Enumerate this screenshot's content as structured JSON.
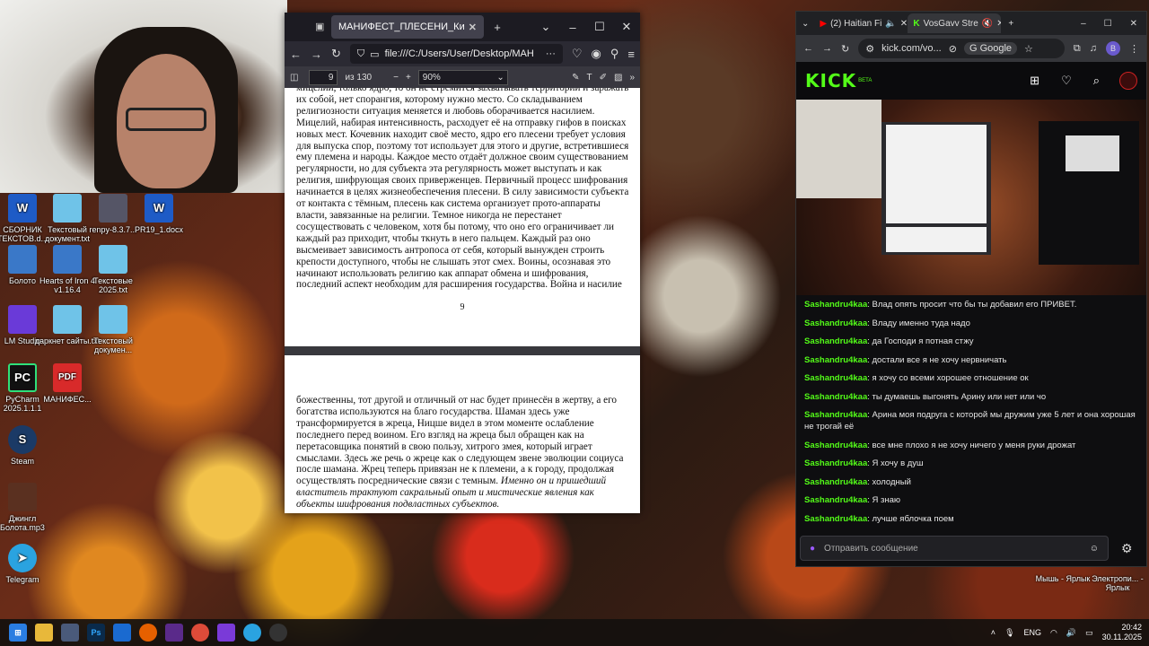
{
  "desktop": {
    "icons": [
      {
        "label": "СБОРНИК ТЕКСТОВ.d...",
        "glyph": "W",
        "color": "#1e5bc6"
      },
      {
        "label": "Текстовый документ.txt",
        "glyph": "",
        "color": "#6fc3e8"
      },
      {
        "label": "renpy-8.3.7...",
        "glyph": "",
        "color": "#556"
      },
      {
        "label": "PR19_1.docx",
        "glyph": "W",
        "color": "#1e5bc6"
      },
      {
        "label": "Болото",
        "glyph": "",
        "color": "#3a78c8"
      },
      {
        "label": "Hearts of Iron 4 v1.16.4",
        "glyph": "",
        "color": "#3a78c8"
      },
      {
        "label": "Текстовые 2025.txt",
        "glyph": "",
        "color": "#6fc3e8"
      },
      {
        "label": "LM Studio",
        "glyph": "",
        "color": "#6a3ad8"
      },
      {
        "label": "даркнет сайты.txt",
        "glyph": "",
        "color": "#6fc3e8"
      },
      {
        "label": "Текстовый докумен...",
        "glyph": "",
        "color": "#6fc3e8"
      },
      {
        "label": "PyCharm 2025.1.1.1",
        "glyph": "PC",
        "color": "#111"
      },
      {
        "label": "МАНИФЕС...",
        "glyph": "PDF",
        "color": "#d82a2a"
      },
      {
        "label": "Steam",
        "glyph": "S",
        "color": "#1b3a66"
      },
      {
        "label": "Джингл Болота.mp3",
        "glyph": "",
        "color": "#5a3020"
      },
      {
        "label": "Telegram",
        "glyph": "➤",
        "color": "#2aa3e0"
      },
      {
        "label": "Мышь - Ярлык",
        "glyph": "",
        "color": "transparent"
      },
      {
        "label": "Электропи... - Ярлык",
        "glyph": "",
        "color": "transparent"
      }
    ]
  },
  "pdf_window": {
    "tab_title": "МАНИФЕСТ_ПЛЕСЕНИ_Кирилл_...",
    "url": "file:///C:/Users/User/Desktop/МАН",
    "page_current": "9",
    "page_total": "из 130",
    "zoom": "90%",
    "page1_text": "мицелий, только ядро, то он не стремится захватывать территории и заражать их собой, нет спорангия, которому нужно место. Со складыванием религиозности ситуация меняется и любовь оборачивается насилием. Мицелий, набирая интенсивность, расходует её на отправку гифов в поисках новых мест. Кочевник находит своё место, ядро его плесени требует условия для выпуска спор, поэтому тот использует для этого и другие, встретившиеся ему племена и народы. Каждое место отдаёт должное своим существованием регулярности, но для субъекта эта регулярность может выступать и как религия, шифрующая своих приверженцев. Первичный процесс шифрования начинается в целях жизнеобеспечения плесени. В силу зависимости субъекта от контакта с тёмным, плесень как система организует прото-аппараты власти, завязанные на религии. Темное никогда не перестанет сосуществовать с человеком, хотя бы потому, что оно его ограничивает ли каждый раз приходит, чтобы ткнуть в него пальцем. Каждый раз оно высмеивает зависимость антропоса от себя, который вынужден строить крепости доступного, чтобы не слышать этот смех. Воины, осознавая это начинают использовать религию как аппарат обмена и шифрования, последний аспект необходим для расширения государства. Война и насилие",
    "page1_number": "9",
    "page2_text": "божественны, тот другой и отличный от нас будет принесён в жертву, а его богатства используются на благо государства. Шаман здесь уже трансформируется в жреца, Ницше видел в этом моменте ослабление последнего перед воином. Его взгляд на жреца был обращен как на перетасовщика понятий в свою пользу, хитрого змея, который играет смыслами. Здесь же речь о жреце как о следующем звене эволюции социуса после шамана. Жрец теперь привязан не к племени, а к городу, продолжая осуществлять посреднические связи с темным.",
    "page2_italic": "Именно он и пришедший властитель трактуют сакральный опыт и мистические явления как объекты шифрования подвластных субъектов."
  },
  "kick_window": {
    "tab1": "(2) Haitian Fi",
    "tab2": "VosGavv Stre",
    "url": "kick.com/vo...",
    "search_engine": "Google",
    "profile": "B",
    "logo": "KICK",
    "logo_badge": "BETA",
    "chat_input_placeholder": "Отправить сообщение",
    "chat": [
      {
        "user": "Sashandru4kaa",
        "text": "Влад опять просит что бы ты добавил его ПРИВЕТ."
      },
      {
        "user": "Sashandru4kaa",
        "text": "Владу именно туда надо"
      },
      {
        "user": "Sashandru4kaa",
        "text": "да Господи я потная стжу"
      },
      {
        "user": "Sashandru4kaa",
        "text": "достали все я не хочу нервничать"
      },
      {
        "user": "Sashandru4kaa",
        "text": "я хочу со всеми хорошее отношение ок"
      },
      {
        "user": "Sashandru4kaa",
        "text": "ты думаешь выгонять Арину или нет или чо"
      },
      {
        "user": "Sashandru4kaa",
        "text": "Арина моя подруга с которой мы дружим уже 5 лет и она хорошая не трогай её"
      },
      {
        "user": "Sashandru4kaa",
        "text": "все мне плохо я не хочу ничего у меня руки дрожат"
      },
      {
        "user": "Sashandru4kaa",
        "text": "Я хочу в душ"
      },
      {
        "user": "Sashandru4kaa",
        "text": "холодный"
      },
      {
        "user": "Sashandru4kaa",
        "text": "Я знаю"
      },
      {
        "user": "Sashandru4kaa",
        "text": "лучше яблочка поем"
      }
    ]
  },
  "taskbar": {
    "lang": "ENG",
    "time": "20:42",
    "date": "30.11.2025"
  }
}
